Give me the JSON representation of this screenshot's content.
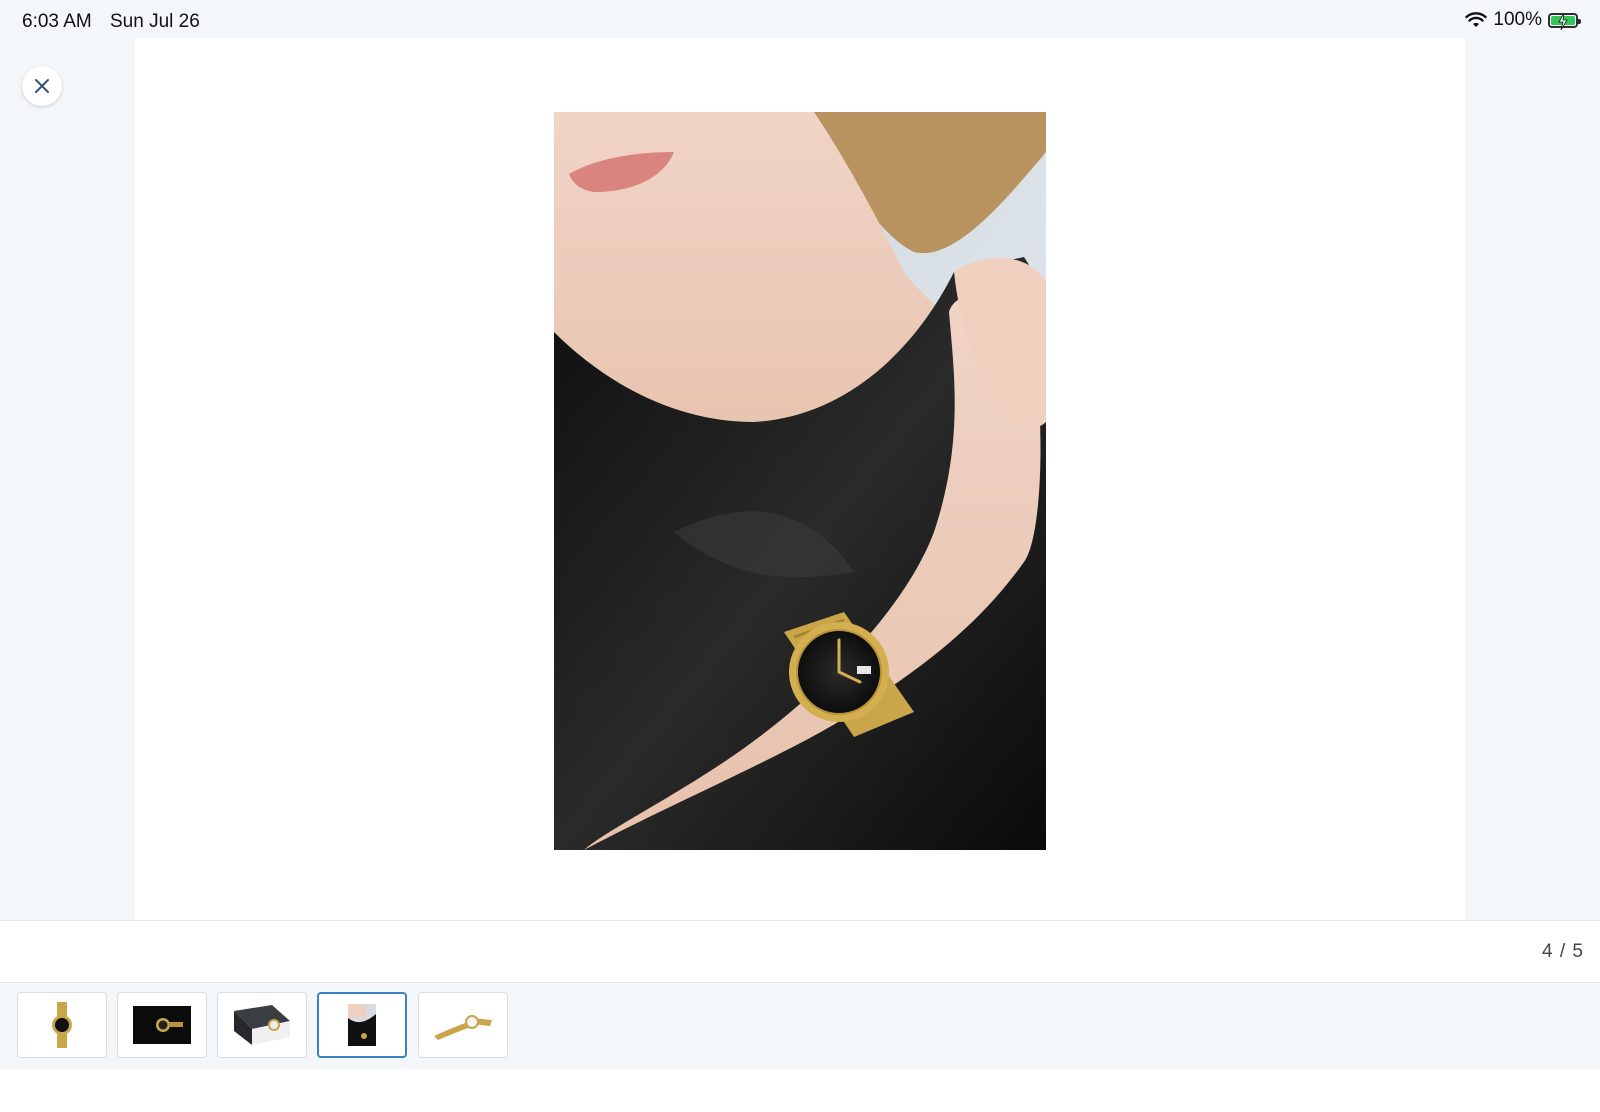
{
  "status_bar": {
    "time": "6:03 AM",
    "date": "Sun Jul 26",
    "battery_percent": "100%",
    "battery_level": 1.0,
    "icons": [
      "wifi-icon",
      "battery-charging-icon"
    ]
  },
  "viewer": {
    "close_icon": "close-icon",
    "main_image": "woman-black-dress-gold-watch-photo"
  },
  "pager": {
    "counter": "4 / 5",
    "current_index": 4,
    "total": 5
  },
  "thumbnails": [
    {
      "name": "watch-front-thumbnail",
      "active": false
    },
    {
      "name": "watch-dark-thumbnail",
      "active": false
    },
    {
      "name": "watch-box-thumbnail",
      "active": false
    },
    {
      "name": "model-wrist-thumbnail",
      "active": true
    },
    {
      "name": "watch-side-thumbnail",
      "active": false
    }
  ],
  "colors": {
    "accent": "#3b82c4",
    "battery": "#34c759",
    "background": "#f3f7fa"
  }
}
